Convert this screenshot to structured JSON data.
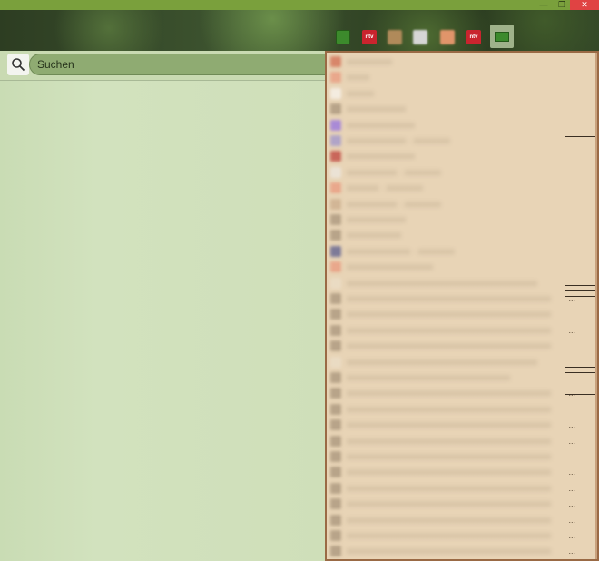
{
  "window": {
    "minimize_glyph": "—",
    "maximize_glyph": "❐",
    "close_glyph": "✕"
  },
  "bookmarks": [
    {
      "kind": "folder",
      "icon": "folder-icon"
    },
    {
      "kind": "ntv",
      "label": "ntv",
      "icon": "ntv-icon"
    },
    {
      "kind": "blurred",
      "icon": "site-icon"
    },
    {
      "kind": "blurred",
      "icon": "site-icon"
    },
    {
      "kind": "blurred",
      "icon": "site-icon"
    },
    {
      "kind": "ntv",
      "label": "ntv",
      "icon": "ntv-icon"
    },
    {
      "kind": "folder-active",
      "icon": "folder-icon"
    }
  ],
  "search": {
    "placeholder": "Suchen",
    "icon": "search-icon"
  },
  "colors": {
    "titlebar": "#7aa03c",
    "close": "#e04343",
    "pane": "#cfdfb8",
    "dropdown": "#e8d4b6",
    "dropdown_border": "#9a6a45"
  },
  "dropdown_items": [
    {
      "label": "xxxxxxxxxx",
      "color": "#d8866a"
    },
    {
      "label": "xxxxx",
      "color": "#e9a88c"
    },
    {
      "label": "xxxxxx",
      "color": "#f4ece0"
    },
    {
      "label": "xxxxxxxxxxxxx",
      "color": "#b8a489"
    },
    {
      "label": "xxxxxxxxxxxxxxx",
      "color": "#a98ad6"
    },
    {
      "label": "xxxxxxxxxxxxx · xxxxxxxx",
      "color": "#b0a4c8"
    },
    {
      "label": "xxxxxxxxxxxxxxx",
      "color": "#c9675a"
    },
    {
      "label": "xxxxxxxxxxx · xxxxxxxx",
      "color": "#ebe2d5"
    },
    {
      "label": "xxxxxxx · xxxxxxxx",
      "color": "#e9a88c"
    },
    {
      "label": "xxxxxxxxxxx · xxxxxxxx",
      "color": "#d2b696"
    },
    {
      "label": "xxxxxxxxxxxxx",
      "color": "#b8a489"
    },
    {
      "label": "xxxxxxxxxxxx",
      "color": "#b8a489"
    },
    {
      "label": "xxxxxxxxxxxxxx · xxxxxxxx",
      "color": "#7d7a98"
    },
    {
      "label": "xxxxxxxxxxxxxxxxxxx",
      "color": "#e9a88c"
    },
    {
      "label": "xxxxxxxxxxxxxxxxxxxxxxxxxxxxxxxxxxxxxxxxxx",
      "color": "#eadbc3"
    },
    {
      "label": "xxxxxxxxxxxxxxxxxxxxxxxxxxxxxxxxxxxxxxxxxxxxx",
      "color": "#b8a489",
      "ellipsis": "..."
    },
    {
      "label": "xxxxxxxxxxxxxxxxxxxxxxxxxxxxxxxxxxxxxxxxxxxxx",
      "color": "#b8a489"
    },
    {
      "label": "xxxxxxxxxxxxxxxxxxxxxxxxxxxxxxxxxxxxxxxxxxxxx",
      "color": "#b8a489",
      "ellipsis": "..."
    },
    {
      "label": "xxxxxxxxxxxxxxxxxxxxxxxxxxxxxxxxxxxxxxxxxxxxx",
      "color": "#b8a489"
    },
    {
      "label": "xxxxxxxxxxxxxxxxxxxxxxxxxxxxxxxxxxxxxxxxxx",
      "color": "#eadbc3"
    },
    {
      "label": "xxxxxxxxxxxxxxxxxxxxxxxxxxxxxxxxxxxx",
      "color": "#b8a489"
    },
    {
      "label": "xxxxxxxxxxxxxxxxxxxxxxxxxxxxxxxxxxxxxxxxxxxxx",
      "color": "#b8a489",
      "ellipsis": "..."
    },
    {
      "label": "xxxxxxxxxxxxxxxxxxxxxxxxxxxxxxxxxxxxxxxxxxxxx",
      "color": "#b8a489"
    },
    {
      "label": "xxxxxxxxxxxxxxxxxxxxxxxxxxxxxxxxxxxxxxxxxxxxx",
      "color": "#b8a489",
      "ellipsis": "..."
    },
    {
      "label": "xxxxxxxxxxxxxxxxxxxxxxxxxxxxxxxxxxxxxxxxxxxxx",
      "color": "#b8a489",
      "ellipsis": "..."
    },
    {
      "label": "xxxxxxxxxxxxxxxxxxxxxxxxxxxxxxxxxxxxxxxxxxxxx",
      "color": "#b8a489"
    },
    {
      "label": "xxxxxxxxxxxxxxxxxxxxxxxxxxxxxxxxxxxxxxxxxxxxx",
      "color": "#b8a489",
      "ellipsis": "..."
    },
    {
      "label": "xxxxxxxxxxxxxxxxxxxxxxxxxxxxxxxxxxxxxxxxxxxxx",
      "color": "#b8a489",
      "ellipsis": "..."
    },
    {
      "label": "xxxxxxxxxxxxxxxxxxxxxxxxxxxxxxxxxxxxxxxxxxxxx",
      "color": "#b8a489",
      "ellipsis": "..."
    },
    {
      "label": "xxxxxxxxxxxxxxxxxxxxxxxxxxxxxxxxxxxxxxxxxxxxx",
      "color": "#b8a489",
      "ellipsis": "..."
    },
    {
      "label": "xxxxxxxxxxxxxxxxxxxxxxxxxxxxxxxxxxxxxxxxxxxxx",
      "color": "#b8a489",
      "ellipsis": "..."
    },
    {
      "label": "xxxxxxxxxxxxxxxxxxxxxxxxxxxxxxxxxxxxxxxxxxxxx",
      "color": "#b8a489",
      "ellipsis": "..."
    }
  ]
}
